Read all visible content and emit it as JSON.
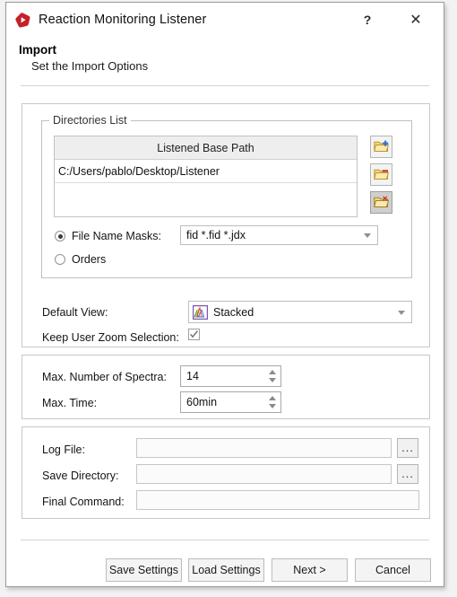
{
  "window": {
    "title": "Reaction Monitoring Listener",
    "icon": "app-logo-icon",
    "help_label": "?",
    "close_label": "✕"
  },
  "header": {
    "title": "Import",
    "subtitle": "Set the Import Options"
  },
  "directories_group": {
    "legend": "Directories List",
    "table": {
      "column_header": "Listened Base Path",
      "rows": [
        "C:/Users/pablo/Desktop/Listener",
        ""
      ]
    },
    "tools": [
      {
        "name": "add-directory-button",
        "icon": "folder-add-icon",
        "pressed": false
      },
      {
        "name": "remove-directory-button",
        "icon": "folder-remove-icon",
        "pressed": false
      },
      {
        "name": "delete-directory-button",
        "icon": "folder-delete-icon",
        "pressed": true
      }
    ],
    "filter_mode": {
      "masks_label": "File Name Masks:",
      "masks_selected": true,
      "orders_label": "Orders",
      "orders_selected": false,
      "masks_value": "fid *.fid *.jdx"
    }
  },
  "view_options": {
    "default_view_label": "Default View:",
    "default_view_value": "Stacked",
    "default_view_icon": "stacked-spectra-icon",
    "keep_zoom_label": "Keep User Zoom Selection:",
    "keep_zoom_checked": true
  },
  "limits": {
    "max_spectra_label": "Max. Number of Spectra:",
    "max_spectra_value": "14",
    "max_time_label": "Max. Time:",
    "max_time_value": "60min"
  },
  "paths": {
    "log_file_label": "Log File:",
    "log_file_value": "",
    "save_directory_label": "Save Directory:",
    "save_directory_value": "",
    "final_command_label": "Final Command:",
    "final_command_value": "",
    "browse_label": "..."
  },
  "footer": {
    "save_settings": "Save Settings",
    "load_settings": "Load Settings",
    "next": "Next >",
    "cancel": "Cancel"
  },
  "colors": {
    "accent_red": "#c62027",
    "folder_yellow": "#f2d479",
    "add_blue": "#3b6fc4",
    "remove_red": "#c0392b",
    "chart_border_purple": "#7b52b5"
  }
}
